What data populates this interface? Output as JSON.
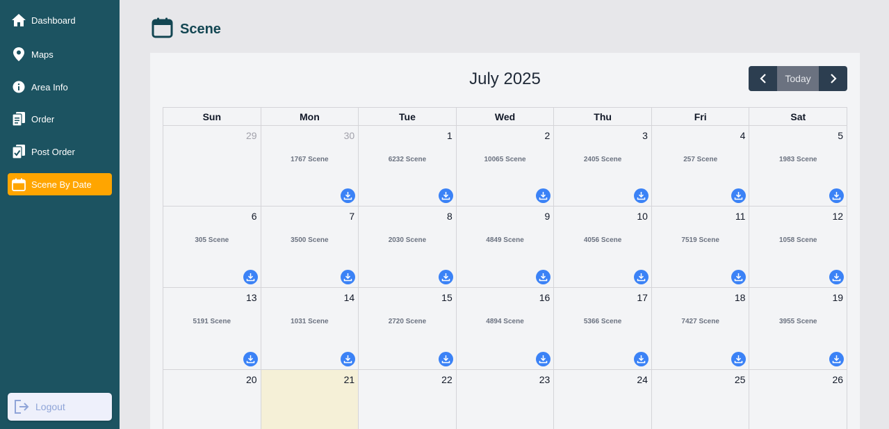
{
  "sidebar": {
    "items": [
      {
        "label": "Dashboard",
        "icon": "home-icon",
        "active": false
      },
      {
        "label": "Maps",
        "icon": "map-pin-icon",
        "active": false
      },
      {
        "label": "Area Info",
        "icon": "info-icon",
        "active": false
      },
      {
        "label": "Order",
        "icon": "clipboard-icon",
        "active": false
      },
      {
        "label": "Post Order",
        "icon": "clipboard-check-icon",
        "active": false
      },
      {
        "label": "Scene By Date",
        "icon": "calendar-icon",
        "active": true
      }
    ],
    "logout_label": "Logout"
  },
  "page": {
    "title": "Scene"
  },
  "calendar": {
    "month_label": "July 2025",
    "today_label": "Today",
    "weekdays": [
      "Sun",
      "Mon",
      "Tue",
      "Wed",
      "Thu",
      "Fri",
      "Sat"
    ],
    "weeks": [
      [
        {
          "day": "29",
          "other": true,
          "count": ""
        },
        {
          "day": "30",
          "other": true,
          "count": "1767 Scene"
        },
        {
          "day": "1",
          "count": "6232 Scene"
        },
        {
          "day": "2",
          "count": "10065 Scene"
        },
        {
          "day": "3",
          "count": "2405 Scene"
        },
        {
          "day": "4",
          "count": "257 Scene"
        },
        {
          "day": "5",
          "count": "1983 Scene"
        }
      ],
      [
        {
          "day": "6",
          "count": "305 Scene"
        },
        {
          "day": "7",
          "count": "3500 Scene"
        },
        {
          "day": "8",
          "count": "2030 Scene"
        },
        {
          "day": "9",
          "count": "4849 Scene"
        },
        {
          "day": "10",
          "count": "4056 Scene"
        },
        {
          "day": "11",
          "count": "7519 Scene"
        },
        {
          "day": "12",
          "count": "1058 Scene"
        }
      ],
      [
        {
          "day": "13",
          "count": "5191 Scene"
        },
        {
          "day": "14",
          "count": "1031 Scene"
        },
        {
          "day": "15",
          "count": "2720 Scene"
        },
        {
          "day": "16",
          "count": "4894 Scene"
        },
        {
          "day": "17",
          "count": "5366 Scene"
        },
        {
          "day": "18",
          "count": "7427 Scene"
        },
        {
          "day": "19",
          "count": "3955 Scene"
        }
      ],
      [
        {
          "day": "20",
          "count": ""
        },
        {
          "day": "21",
          "today": true,
          "count": ""
        },
        {
          "day": "22",
          "count": ""
        },
        {
          "day": "23",
          "count": ""
        },
        {
          "day": "24",
          "count": ""
        },
        {
          "day": "25",
          "count": ""
        },
        {
          "day": "26",
          "count": ""
        }
      ]
    ]
  },
  "colors": {
    "sidebar": "#1c5361",
    "active": "#ffa500",
    "download": "#3b82f6",
    "today_cell": "#f5f0d7"
  }
}
